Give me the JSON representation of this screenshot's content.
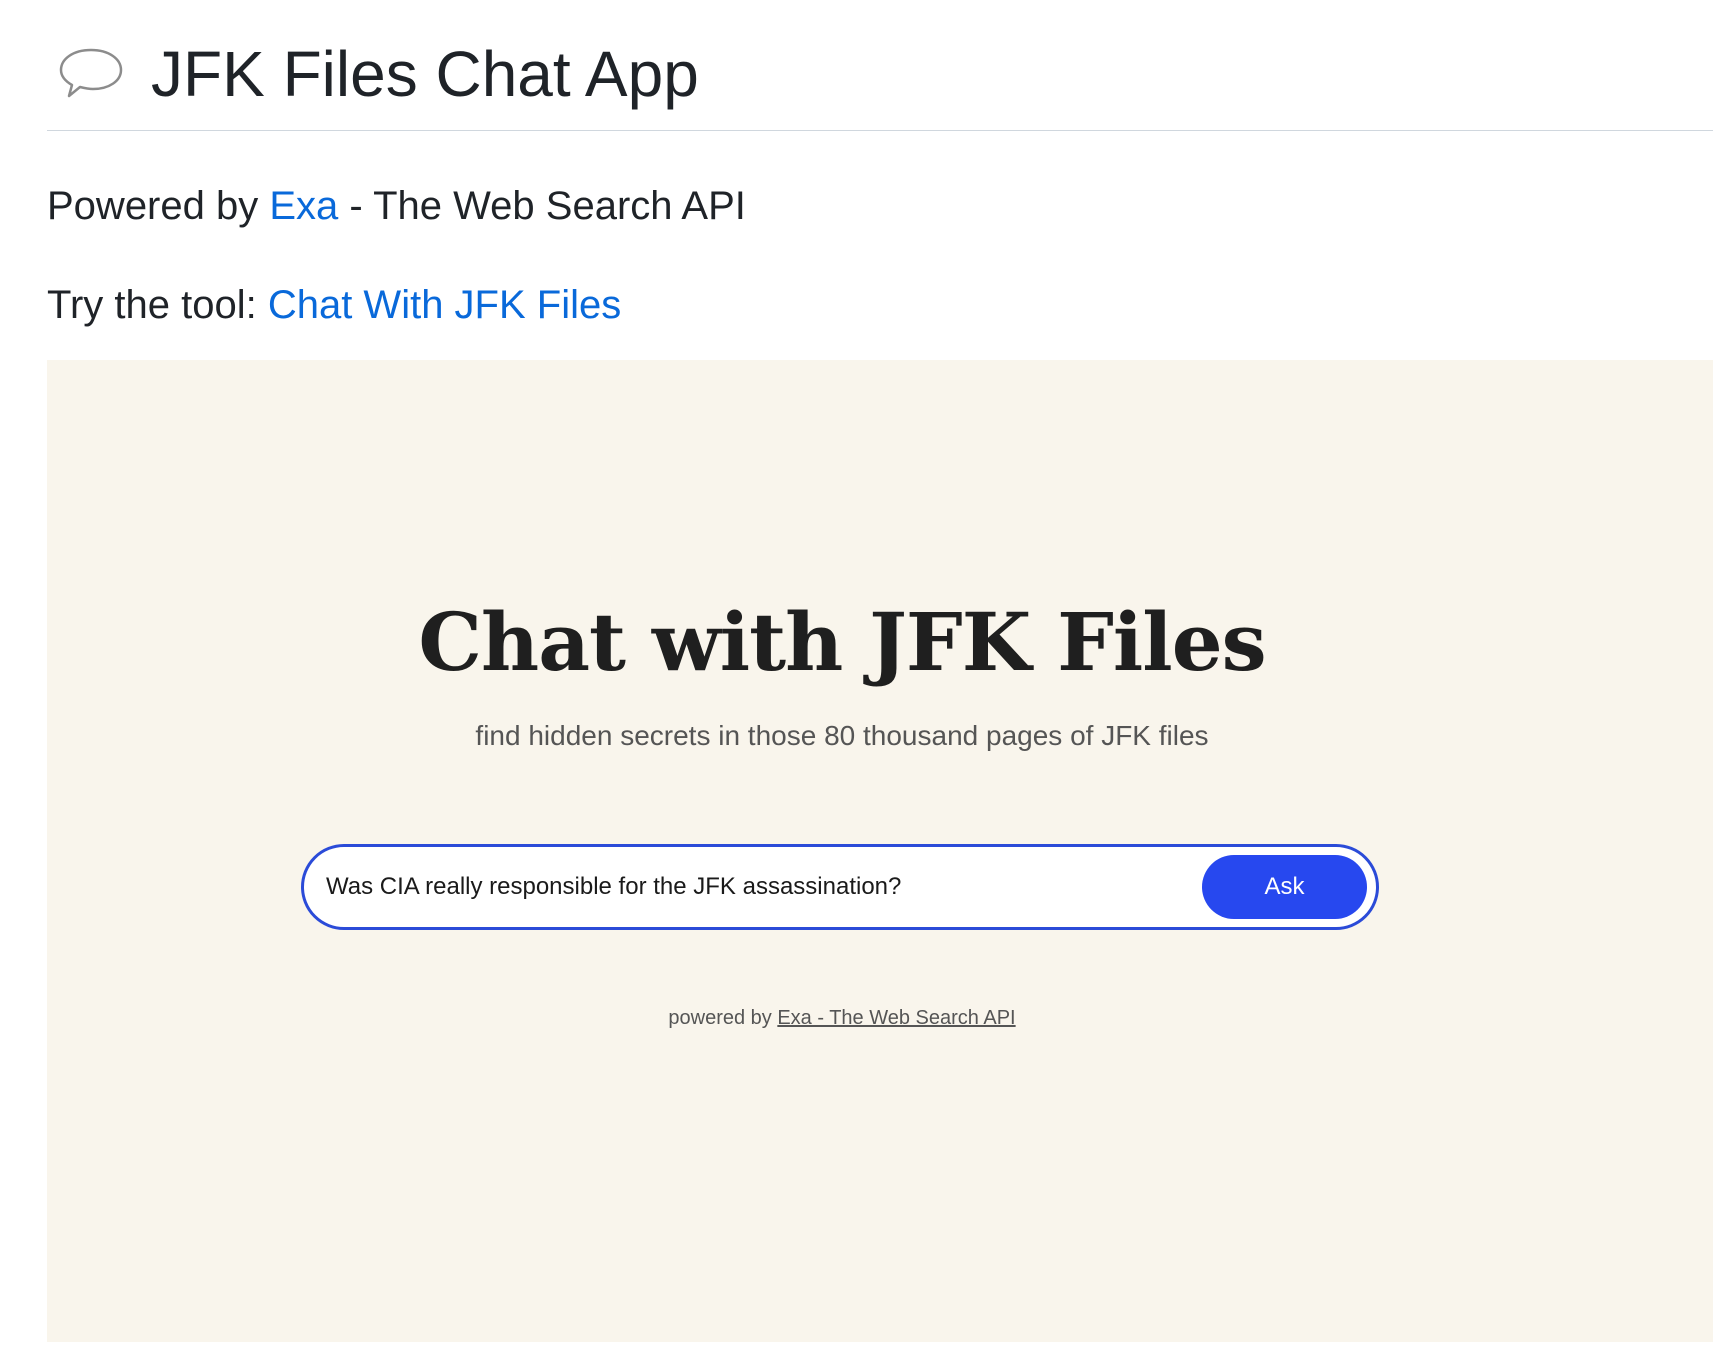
{
  "header": {
    "icon": "speech-bubble-icon",
    "title": "JFK Files Chat App"
  },
  "powered": {
    "prefix": "Powered by ",
    "link_text": "Exa",
    "suffix": " - The Web Search API"
  },
  "try_tool": {
    "prefix": "Try the tool: ",
    "link_text": "Chat With JFK Files"
  },
  "embed": {
    "title": "Chat with JFK Files",
    "subtitle": "find hidden secrets in those 80 thousand pages of JFK files",
    "search": {
      "value": "Was CIA really responsible for the JFK assassination?",
      "button_label": "Ask"
    },
    "footer": {
      "prefix": "powered by ",
      "link_text": "Exa - The Web Search API"
    }
  },
  "colors": {
    "link": "#0969da",
    "embed_background": "#f9f5ec",
    "accent": "#2748ef"
  }
}
